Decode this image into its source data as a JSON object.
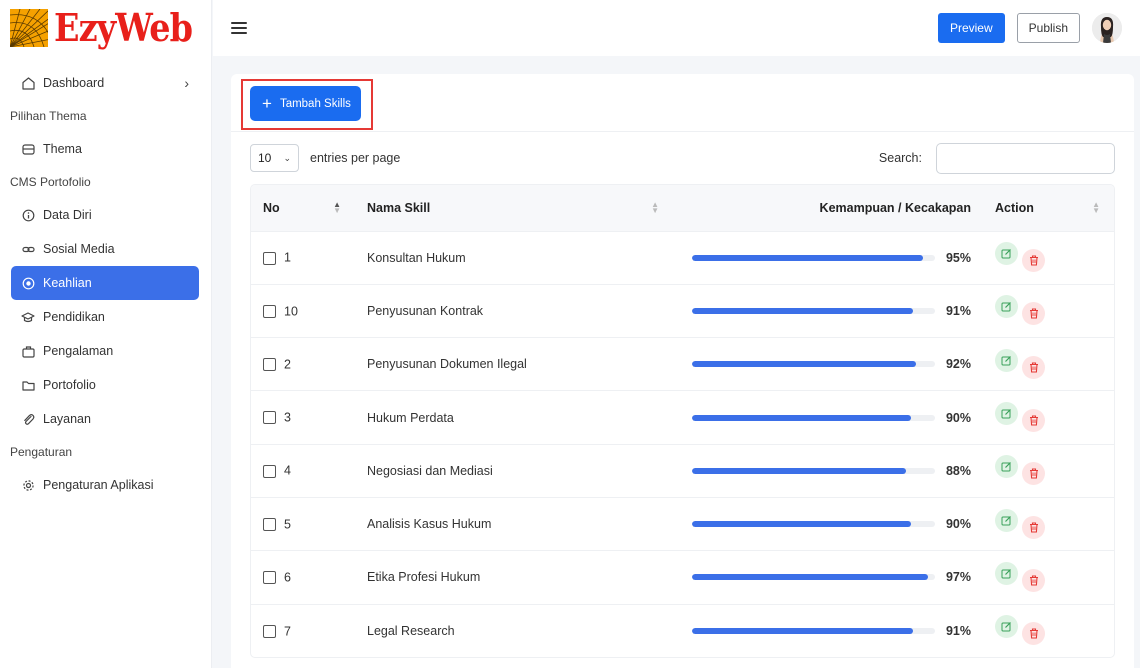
{
  "brand": {
    "name": "EzyWeb"
  },
  "sidebar": {
    "dashboard": "Dashboard",
    "sections": {
      "thema": "Pilihan Thema",
      "cms": "CMS Portofolio",
      "settings": "Pengaturan"
    },
    "items": {
      "thema": "Thema",
      "data_diri": "Data Diri",
      "sosial_media": "Sosial Media",
      "keahlian": "Keahlian",
      "pendidikan": "Pendidikan",
      "pengalaman": "Pengalaman",
      "portofolio": "Portofolio",
      "layanan": "Layanan",
      "pengaturan_aplikasi": "Pengaturan Aplikasi"
    },
    "active": "keahlian"
  },
  "header": {
    "preview_label": "Preview",
    "publish_label": "Publish"
  },
  "card": {
    "add_button_label": "Tambah Skills",
    "page_size": "10",
    "entries_label": "entries per page",
    "search_label": "Search:",
    "search_value": ""
  },
  "table": {
    "columns": {
      "no": "No",
      "name": "Nama Skill",
      "skill": "Kemampuan / Kecakapan",
      "action": "Action"
    },
    "rows": [
      {
        "no": "1",
        "name": "Konsultan Hukum",
        "percent": 95,
        "percent_label": "95%"
      },
      {
        "no": "10",
        "name": "Penyusunan Kontrak",
        "percent": 91,
        "percent_label": "91%"
      },
      {
        "no": "2",
        "name": "Penyusunan Dokumen Ilegal",
        "percent": 92,
        "percent_label": "92%"
      },
      {
        "no": "3",
        "name": "Hukum Perdata",
        "percent": 90,
        "percent_label": "90%"
      },
      {
        "no": "4",
        "name": "Negosiasi dan Mediasi",
        "percent": 88,
        "percent_label": "88%"
      },
      {
        "no": "5",
        "name": "Analisis Kasus Hukum",
        "percent": 90,
        "percent_label": "90%"
      },
      {
        "no": "6",
        "name": "Etika Profesi Hukum",
        "percent": 97,
        "percent_label": "97%"
      },
      {
        "no": "7",
        "name": "Legal Research",
        "percent": 91,
        "percent_label": "91%"
      }
    ]
  },
  "colors": {
    "primary": "#1a6cf0",
    "active_nav": "#3b6fe8",
    "progress": "#3b6fe8",
    "edit_bg": "#dff3e4",
    "delete_bg": "#fde3e3",
    "highlight": "#e53935"
  }
}
